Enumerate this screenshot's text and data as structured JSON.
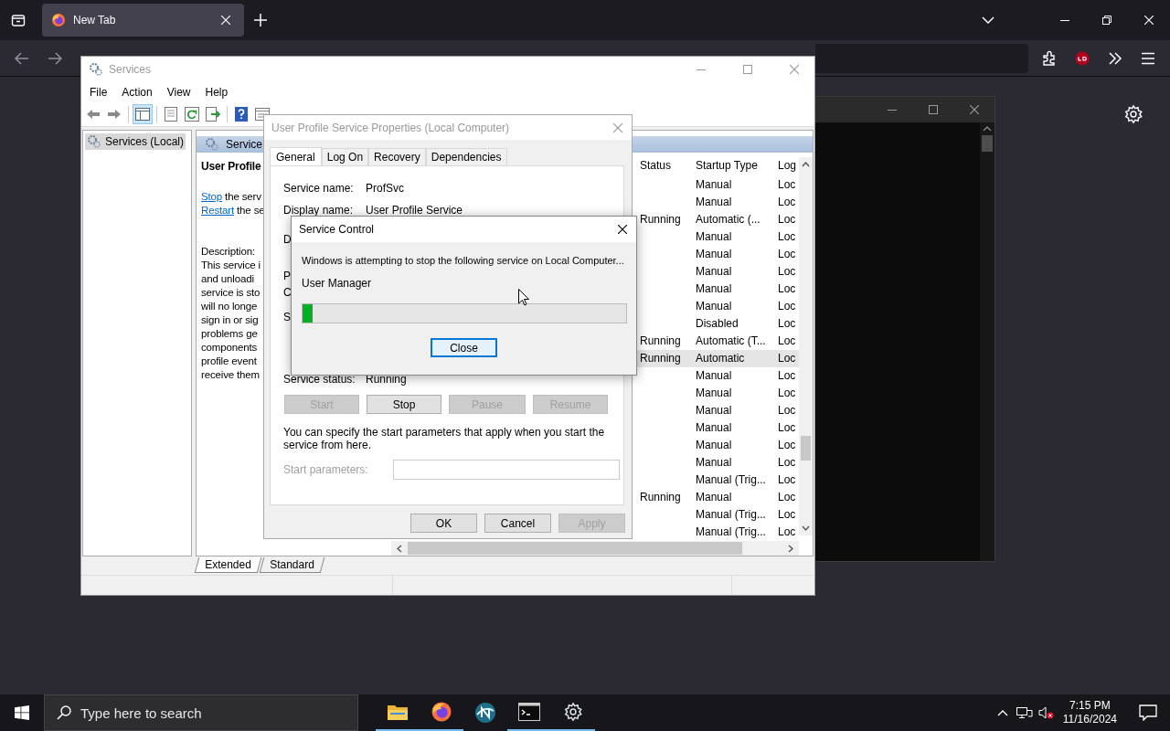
{
  "browser": {
    "tabs": [
      {
        "label": "New Tab",
        "selected": true
      }
    ]
  },
  "services_window": {
    "title": "Services",
    "menu": [
      "File",
      "Action",
      "View",
      "Help"
    ],
    "tree": [
      {
        "label": "Services (Local)",
        "selected": true
      }
    ],
    "pane_header": "Service",
    "detail_title": "User Profile",
    "actions": [
      {
        "link": "Stop",
        "rest": " the serv"
      },
      {
        "link": "Restart",
        "rest": " the se"
      }
    ],
    "description_label": "Description:",
    "description_lines": [
      "This service i",
      "and unloadi",
      "service is sto",
      "will no longe",
      "sign in or sig",
      "problems ge",
      "components",
      "profile event",
      "receive them"
    ],
    "columns": [
      "Status",
      "Startup Type",
      "Log"
    ],
    "rows": [
      {
        "status": "",
        "startup_type": "Manual",
        "log": "Loc",
        "selected": false
      },
      {
        "status": "",
        "startup_type": "Manual",
        "log": "Loc",
        "selected": false
      },
      {
        "status": "Running",
        "startup_type": "Automatic (...",
        "log": "Loc",
        "selected": false
      },
      {
        "status": "",
        "startup_type": "Manual",
        "log": "Loc",
        "selected": false
      },
      {
        "status": "",
        "startup_type": "Manual",
        "log": "Loc",
        "selected": false
      },
      {
        "status": "",
        "startup_type": "Manual",
        "log": "Loc",
        "selected": false
      },
      {
        "status": "",
        "startup_type": "Manual",
        "log": "Loc",
        "selected": false
      },
      {
        "status": "",
        "startup_type": "Manual",
        "log": "Loc",
        "selected": false
      },
      {
        "status": "",
        "startup_type": "Disabled",
        "log": "Loc",
        "selected": false
      },
      {
        "status": "Running",
        "startup_type": "Automatic (T...",
        "log": "Loc",
        "selected": false
      },
      {
        "status": "Running",
        "startup_type": "Automatic",
        "log": "Loc",
        "selected": true
      },
      {
        "status": "",
        "startup_type": "Manual",
        "log": "Loc",
        "selected": false
      },
      {
        "status": "",
        "startup_type": "Manual",
        "log": "Loc",
        "selected": false
      },
      {
        "status": "",
        "startup_type": "Manual",
        "log": "Loc",
        "selected": false
      },
      {
        "status": "",
        "startup_type": "Manual",
        "log": "Loc",
        "selected": false
      },
      {
        "status": "",
        "startup_type": "Manual",
        "log": "Loc",
        "selected": false
      },
      {
        "status": "",
        "startup_type": "Manual",
        "log": "Loc",
        "selected": false
      },
      {
        "status": "",
        "startup_type": "Manual (Trig...",
        "log": "Loc",
        "selected": false
      },
      {
        "status": "Running",
        "startup_type": "Manual",
        "log": "Loc",
        "selected": false
      },
      {
        "status": "",
        "startup_type": "Manual (Trig...",
        "log": "Loc",
        "selected": false
      },
      {
        "status": "",
        "startup_type": "Manual (Trig...",
        "log": "Loc",
        "selected": false
      }
    ],
    "view_tabs": [
      {
        "label": "Extended",
        "selected": true
      },
      {
        "label": "Standard",
        "selected": false
      }
    ]
  },
  "properties_dialog": {
    "title": "User Profile Service Properties (Local Computer)",
    "tabs": [
      {
        "label": "General",
        "selected": true
      },
      {
        "label": "Log On",
        "selected": false
      },
      {
        "label": "Recovery",
        "selected": false
      },
      {
        "label": "Dependencies",
        "selected": false
      }
    ],
    "fields": [
      {
        "label": "Service name:",
        "value": "ProfSvc"
      },
      {
        "label": "Display name:",
        "value": "User Profile Service"
      }
    ],
    "covered_labels": [
      "D",
      "P",
      "C",
      "S"
    ],
    "status_label": "Service status:",
    "status_value": "Running",
    "service_buttons": [
      {
        "label": "Start",
        "disabled": true
      },
      {
        "label": "Stop",
        "disabled": false
      },
      {
        "label": "Pause",
        "disabled": true
      },
      {
        "label": "Resume",
        "disabled": true
      }
    ],
    "hint": "You can specify the start parameters that apply when you start the service from here.",
    "parameters": {
      "label": "Start parameters:",
      "disabled": true
    },
    "buttons": [
      {
        "label": "OK",
        "disabled": false
      },
      {
        "label": "Cancel",
        "disabled": false
      },
      {
        "label": "Apply",
        "disabled": true
      }
    ]
  },
  "service_control": {
    "title": "Service Control",
    "message": "Windows is attempting to stop the following service on Local Computer...",
    "service": "User Manager",
    "level": 0.03,
    "button": "Close"
  },
  "taskbar": {
    "search": {
      "placeholder": "Type here to search"
    },
    "time": "7:15 PM",
    "date": "11/16/2024"
  }
}
